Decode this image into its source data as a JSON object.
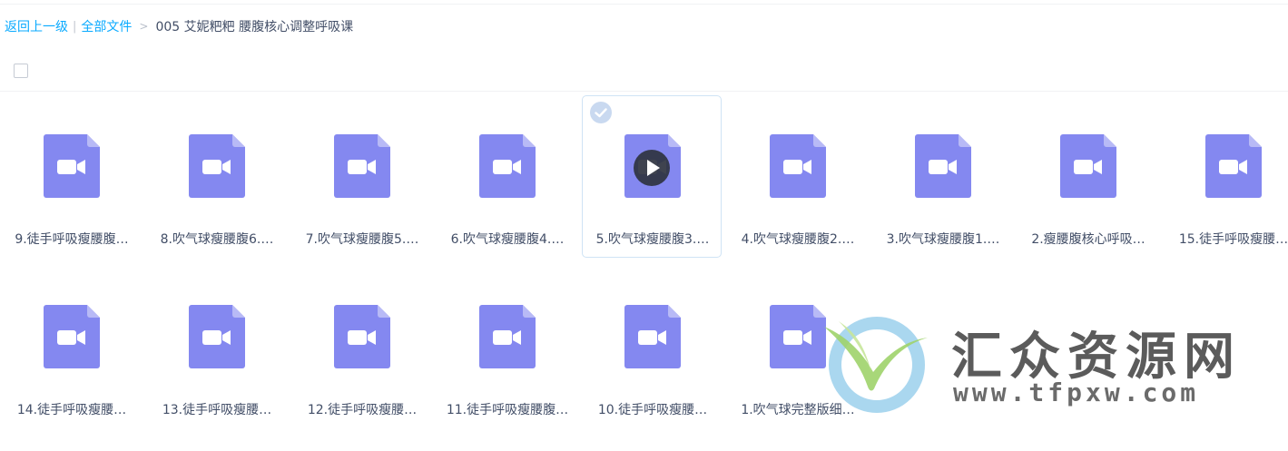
{
  "breadcrumb": {
    "back_label": "返回上一级",
    "separator_bar": "|",
    "root_label": "全部文件",
    "separator_gt": ">",
    "current_folder": "005 艾妮粑粑 腰腹核心调整呼吸课"
  },
  "select_all": {
    "checked": false
  },
  "files": [
    {
      "name": "9.徒手呼吸瘦腰腹…",
      "type": "video",
      "selected": false
    },
    {
      "name": "8.吹气球瘦腰腹6.…",
      "type": "video",
      "selected": false
    },
    {
      "name": "7.吹气球瘦腰腹5.…",
      "type": "video",
      "selected": false
    },
    {
      "name": "6.吹气球瘦腰腹4.…",
      "type": "video",
      "selected": false
    },
    {
      "name": "5.吹气球瘦腰腹3.…",
      "type": "video",
      "selected": true
    },
    {
      "name": "4.吹气球瘦腰腹2.…",
      "type": "video",
      "selected": false
    },
    {
      "name": "3.吹气球瘦腰腹1.…",
      "type": "video",
      "selected": false
    },
    {
      "name": "2.瘦腰腹核心呼吸…",
      "type": "video",
      "selected": false
    },
    {
      "name": "15.徒手呼吸瘦腰…",
      "type": "video",
      "selected": false
    },
    {
      "name": "14.徒手呼吸瘦腰…",
      "type": "video",
      "selected": false
    },
    {
      "name": "13.徒手呼吸瘦腰…",
      "type": "video",
      "selected": false
    },
    {
      "name": "12.徒手呼吸瘦腰…",
      "type": "video",
      "selected": false
    },
    {
      "name": "11.徒手呼吸瘦腰腹…",
      "type": "video",
      "selected": false
    },
    {
      "name": "10.徒手呼吸瘦腰…",
      "type": "video",
      "selected": false
    },
    {
      "name": "1.吹气球完整版细…",
      "type": "video",
      "selected": false
    }
  ],
  "icons": {
    "file_icon": "video-file-icon",
    "selected_badge": "check-circle-icon",
    "play_overlay": "play-icon"
  },
  "colors": {
    "link": "#09aaff",
    "file_icon": "#8488f0",
    "file_icon_fold": "#b8baf6",
    "selected_border": "#cfe3f5",
    "check_badge": "#c9d9f0"
  },
  "watermark": {
    "title": "汇众资源网",
    "url": "www.tfpxw.com"
  }
}
